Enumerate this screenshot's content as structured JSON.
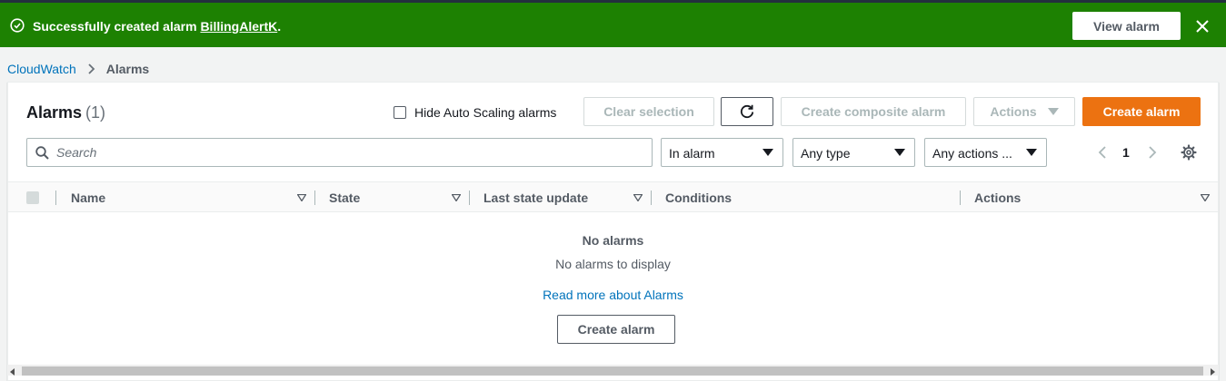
{
  "flash": {
    "message_prefix": "Successfully created alarm ",
    "alarm_link": "BillingAlertK",
    "message_suffix": ".",
    "view_button": "View alarm",
    "icons": {
      "status": "check-circle-icon",
      "close": "close-icon"
    },
    "bg_color": "#1d8102"
  },
  "breadcrumb": {
    "root": "CloudWatch",
    "current": "Alarms"
  },
  "header": {
    "title": "Alarms",
    "count": "(1)",
    "hide_autoscaling_label": "Hide Auto Scaling alarms",
    "hide_autoscaling_checked": false,
    "clear_selection": "Clear selection",
    "create_composite": "Create composite alarm",
    "actions": "Actions",
    "create_alarm": "Create alarm",
    "refresh_icon": "refresh-icon",
    "accent_color": "#ec7211"
  },
  "filters": {
    "search_placeholder": "Search",
    "state": "In alarm",
    "type": "Any type",
    "actions": "Any actions ..."
  },
  "pagination": {
    "current_page": "1"
  },
  "table": {
    "columns": [
      "Name",
      "State",
      "Last state update",
      "Conditions",
      "Actions"
    ]
  },
  "empty": {
    "title": "No alarms",
    "subtitle": "No alarms to display",
    "link": "Read more about Alarms",
    "button": "Create alarm"
  }
}
